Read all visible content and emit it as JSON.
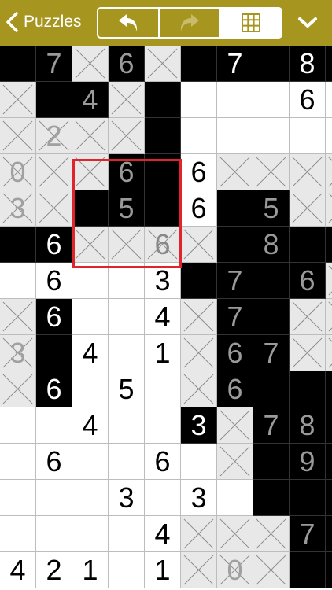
{
  "topbar": {
    "back_label": "Puzzles",
    "back_icon": "chevron-left-icon",
    "undo_icon": "undo-arrow-icon",
    "redo_icon": "redo-arrow-icon",
    "grid_icon": "grid-icon",
    "menu_icon": "chevron-down-icon",
    "active_segment": "grid"
  },
  "colors": {
    "topbar": "#a6951e",
    "selection": "#e0242c",
    "black_cell": "#000000",
    "crossed_cell": "#e8e8e8"
  },
  "board": {
    "rows": [
      [
        "B",
        "B7",
        "X",
        "B6",
        "X",
        "B",
        "B7",
        "B",
        "B8",
        "B"
      ],
      [
        "X",
        "B",
        "B4",
        "X",
        "B",
        "W",
        "W",
        "W",
        "W6",
        "W"
      ],
      [
        "X",
        "X2",
        "X",
        "X",
        "B",
        "W",
        "W",
        "W",
        "W",
        "W"
      ],
      [
        "X0",
        "X",
        "X",
        "B6",
        "B",
        "W6",
        "X",
        "X",
        "X",
        "X"
      ],
      [
        "X3",
        "X",
        "B",
        "B5",
        "B",
        "W6",
        "B",
        "B5",
        "X",
        "X"
      ],
      [
        "B",
        "B6",
        "X",
        "X",
        "X6",
        "X",
        "B",
        "B8",
        "B",
        "B"
      ],
      [
        "W",
        "W6",
        "W",
        "W",
        "W3",
        "B",
        "B7",
        "B",
        "B6",
        "X"
      ],
      [
        "X",
        "B6",
        "W",
        "W",
        "W4",
        "X",
        "B7",
        "B",
        "X",
        "X"
      ],
      [
        "X3",
        "B",
        "W4",
        "W",
        "W1",
        "X",
        "B6",
        "B7",
        "X",
        "X"
      ],
      [
        "X",
        "B6",
        "W",
        "W5",
        "W",
        "X",
        "B6",
        "B",
        "B",
        "B"
      ],
      [
        "W",
        "W",
        "W4",
        "W",
        "W",
        "B3",
        "X",
        "B7",
        "B8",
        "B"
      ],
      [
        "W",
        "W6",
        "W",
        "W",
        "W6",
        "W",
        "X",
        "B",
        "B9",
        "B"
      ],
      [
        "W",
        "W",
        "W",
        "W3",
        "W",
        "W3",
        "W",
        "B",
        "B",
        "B"
      ],
      [
        "W",
        "W",
        "W",
        "W",
        "W4",
        "X",
        "X",
        "X",
        "B7",
        "B"
      ],
      [
        "W4",
        "W2",
        "W1",
        "W",
        "W1",
        "X",
        "X0",
        "X",
        "B",
        "B"
      ]
    ],
    "hint_digits": [
      [
        0,
        1
      ],
      [
        0,
        3
      ],
      [
        1,
        2
      ],
      [
        2,
        1
      ],
      [
        3,
        0
      ],
      [
        3,
        3
      ],
      [
        4,
        0
      ],
      [
        4,
        3
      ],
      [
        4,
        7
      ],
      [
        5,
        7
      ],
      [
        6,
        6
      ],
      [
        6,
        8
      ],
      [
        7,
        6
      ],
      [
        8,
        0
      ],
      [
        8,
        6
      ],
      [
        8,
        7
      ],
      [
        9,
        6
      ],
      [
        10,
        7
      ],
      [
        10,
        8
      ],
      [
        11,
        8
      ],
      [
        13,
        8
      ],
      [
        14,
        6
      ]
    ],
    "selected_block": {
      "row": 3,
      "col": 2,
      "size": 3
    }
  }
}
